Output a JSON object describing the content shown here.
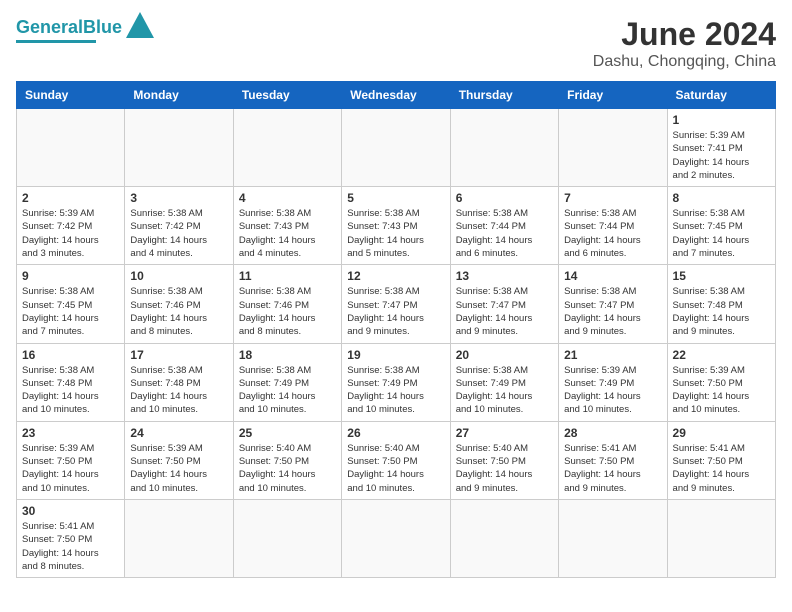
{
  "header": {
    "logo_general": "General",
    "logo_blue": "Blue",
    "month_title": "June 2024",
    "location": "Dashu, Chongqing, China"
  },
  "days_of_week": [
    "Sunday",
    "Monday",
    "Tuesday",
    "Wednesday",
    "Thursday",
    "Friday",
    "Saturday"
  ],
  "weeks": [
    [
      {
        "day": "",
        "info": ""
      },
      {
        "day": "",
        "info": ""
      },
      {
        "day": "",
        "info": ""
      },
      {
        "day": "",
        "info": ""
      },
      {
        "day": "",
        "info": ""
      },
      {
        "day": "",
        "info": ""
      },
      {
        "day": "1",
        "info": "Sunrise: 5:39 AM\nSunset: 7:41 PM\nDaylight: 14 hours\nand 2 minutes."
      }
    ],
    [
      {
        "day": "2",
        "info": "Sunrise: 5:39 AM\nSunset: 7:42 PM\nDaylight: 14 hours\nand 3 minutes."
      },
      {
        "day": "3",
        "info": "Sunrise: 5:38 AM\nSunset: 7:42 PM\nDaylight: 14 hours\nand 4 minutes."
      },
      {
        "day": "4",
        "info": "Sunrise: 5:38 AM\nSunset: 7:43 PM\nDaylight: 14 hours\nand 4 minutes."
      },
      {
        "day": "5",
        "info": "Sunrise: 5:38 AM\nSunset: 7:43 PM\nDaylight: 14 hours\nand 5 minutes."
      },
      {
        "day": "6",
        "info": "Sunrise: 5:38 AM\nSunset: 7:44 PM\nDaylight: 14 hours\nand 6 minutes."
      },
      {
        "day": "7",
        "info": "Sunrise: 5:38 AM\nSunset: 7:44 PM\nDaylight: 14 hours\nand 6 minutes."
      },
      {
        "day": "8",
        "info": "Sunrise: 5:38 AM\nSunset: 7:45 PM\nDaylight: 14 hours\nand 7 minutes."
      }
    ],
    [
      {
        "day": "9",
        "info": "Sunrise: 5:38 AM\nSunset: 7:45 PM\nDaylight: 14 hours\nand 7 minutes."
      },
      {
        "day": "10",
        "info": "Sunrise: 5:38 AM\nSunset: 7:46 PM\nDaylight: 14 hours\nand 8 minutes."
      },
      {
        "day": "11",
        "info": "Sunrise: 5:38 AM\nSunset: 7:46 PM\nDaylight: 14 hours\nand 8 minutes."
      },
      {
        "day": "12",
        "info": "Sunrise: 5:38 AM\nSunset: 7:47 PM\nDaylight: 14 hours\nand 9 minutes."
      },
      {
        "day": "13",
        "info": "Sunrise: 5:38 AM\nSunset: 7:47 PM\nDaylight: 14 hours\nand 9 minutes."
      },
      {
        "day": "14",
        "info": "Sunrise: 5:38 AM\nSunset: 7:47 PM\nDaylight: 14 hours\nand 9 minutes."
      },
      {
        "day": "15",
        "info": "Sunrise: 5:38 AM\nSunset: 7:48 PM\nDaylight: 14 hours\nand 9 minutes."
      }
    ],
    [
      {
        "day": "16",
        "info": "Sunrise: 5:38 AM\nSunset: 7:48 PM\nDaylight: 14 hours\nand 10 minutes."
      },
      {
        "day": "17",
        "info": "Sunrise: 5:38 AM\nSunset: 7:48 PM\nDaylight: 14 hours\nand 10 minutes."
      },
      {
        "day": "18",
        "info": "Sunrise: 5:38 AM\nSunset: 7:49 PM\nDaylight: 14 hours\nand 10 minutes."
      },
      {
        "day": "19",
        "info": "Sunrise: 5:38 AM\nSunset: 7:49 PM\nDaylight: 14 hours\nand 10 minutes."
      },
      {
        "day": "20",
        "info": "Sunrise: 5:38 AM\nSunset: 7:49 PM\nDaylight: 14 hours\nand 10 minutes."
      },
      {
        "day": "21",
        "info": "Sunrise: 5:39 AM\nSunset: 7:49 PM\nDaylight: 14 hours\nand 10 minutes."
      },
      {
        "day": "22",
        "info": "Sunrise: 5:39 AM\nSunset: 7:50 PM\nDaylight: 14 hours\nand 10 minutes."
      }
    ],
    [
      {
        "day": "23",
        "info": "Sunrise: 5:39 AM\nSunset: 7:50 PM\nDaylight: 14 hours\nand 10 minutes."
      },
      {
        "day": "24",
        "info": "Sunrise: 5:39 AM\nSunset: 7:50 PM\nDaylight: 14 hours\nand 10 minutes."
      },
      {
        "day": "25",
        "info": "Sunrise: 5:40 AM\nSunset: 7:50 PM\nDaylight: 14 hours\nand 10 minutes."
      },
      {
        "day": "26",
        "info": "Sunrise: 5:40 AM\nSunset: 7:50 PM\nDaylight: 14 hours\nand 10 minutes."
      },
      {
        "day": "27",
        "info": "Sunrise: 5:40 AM\nSunset: 7:50 PM\nDaylight: 14 hours\nand 9 minutes."
      },
      {
        "day": "28",
        "info": "Sunrise: 5:41 AM\nSunset: 7:50 PM\nDaylight: 14 hours\nand 9 minutes."
      },
      {
        "day": "29",
        "info": "Sunrise: 5:41 AM\nSunset: 7:50 PM\nDaylight: 14 hours\nand 9 minutes."
      }
    ],
    [
      {
        "day": "30",
        "info": "Sunrise: 5:41 AM\nSunset: 7:50 PM\nDaylight: 14 hours\nand 8 minutes."
      },
      {
        "day": "",
        "info": ""
      },
      {
        "day": "",
        "info": ""
      },
      {
        "day": "",
        "info": ""
      },
      {
        "day": "",
        "info": ""
      },
      {
        "day": "",
        "info": ""
      },
      {
        "day": "",
        "info": ""
      }
    ]
  ]
}
